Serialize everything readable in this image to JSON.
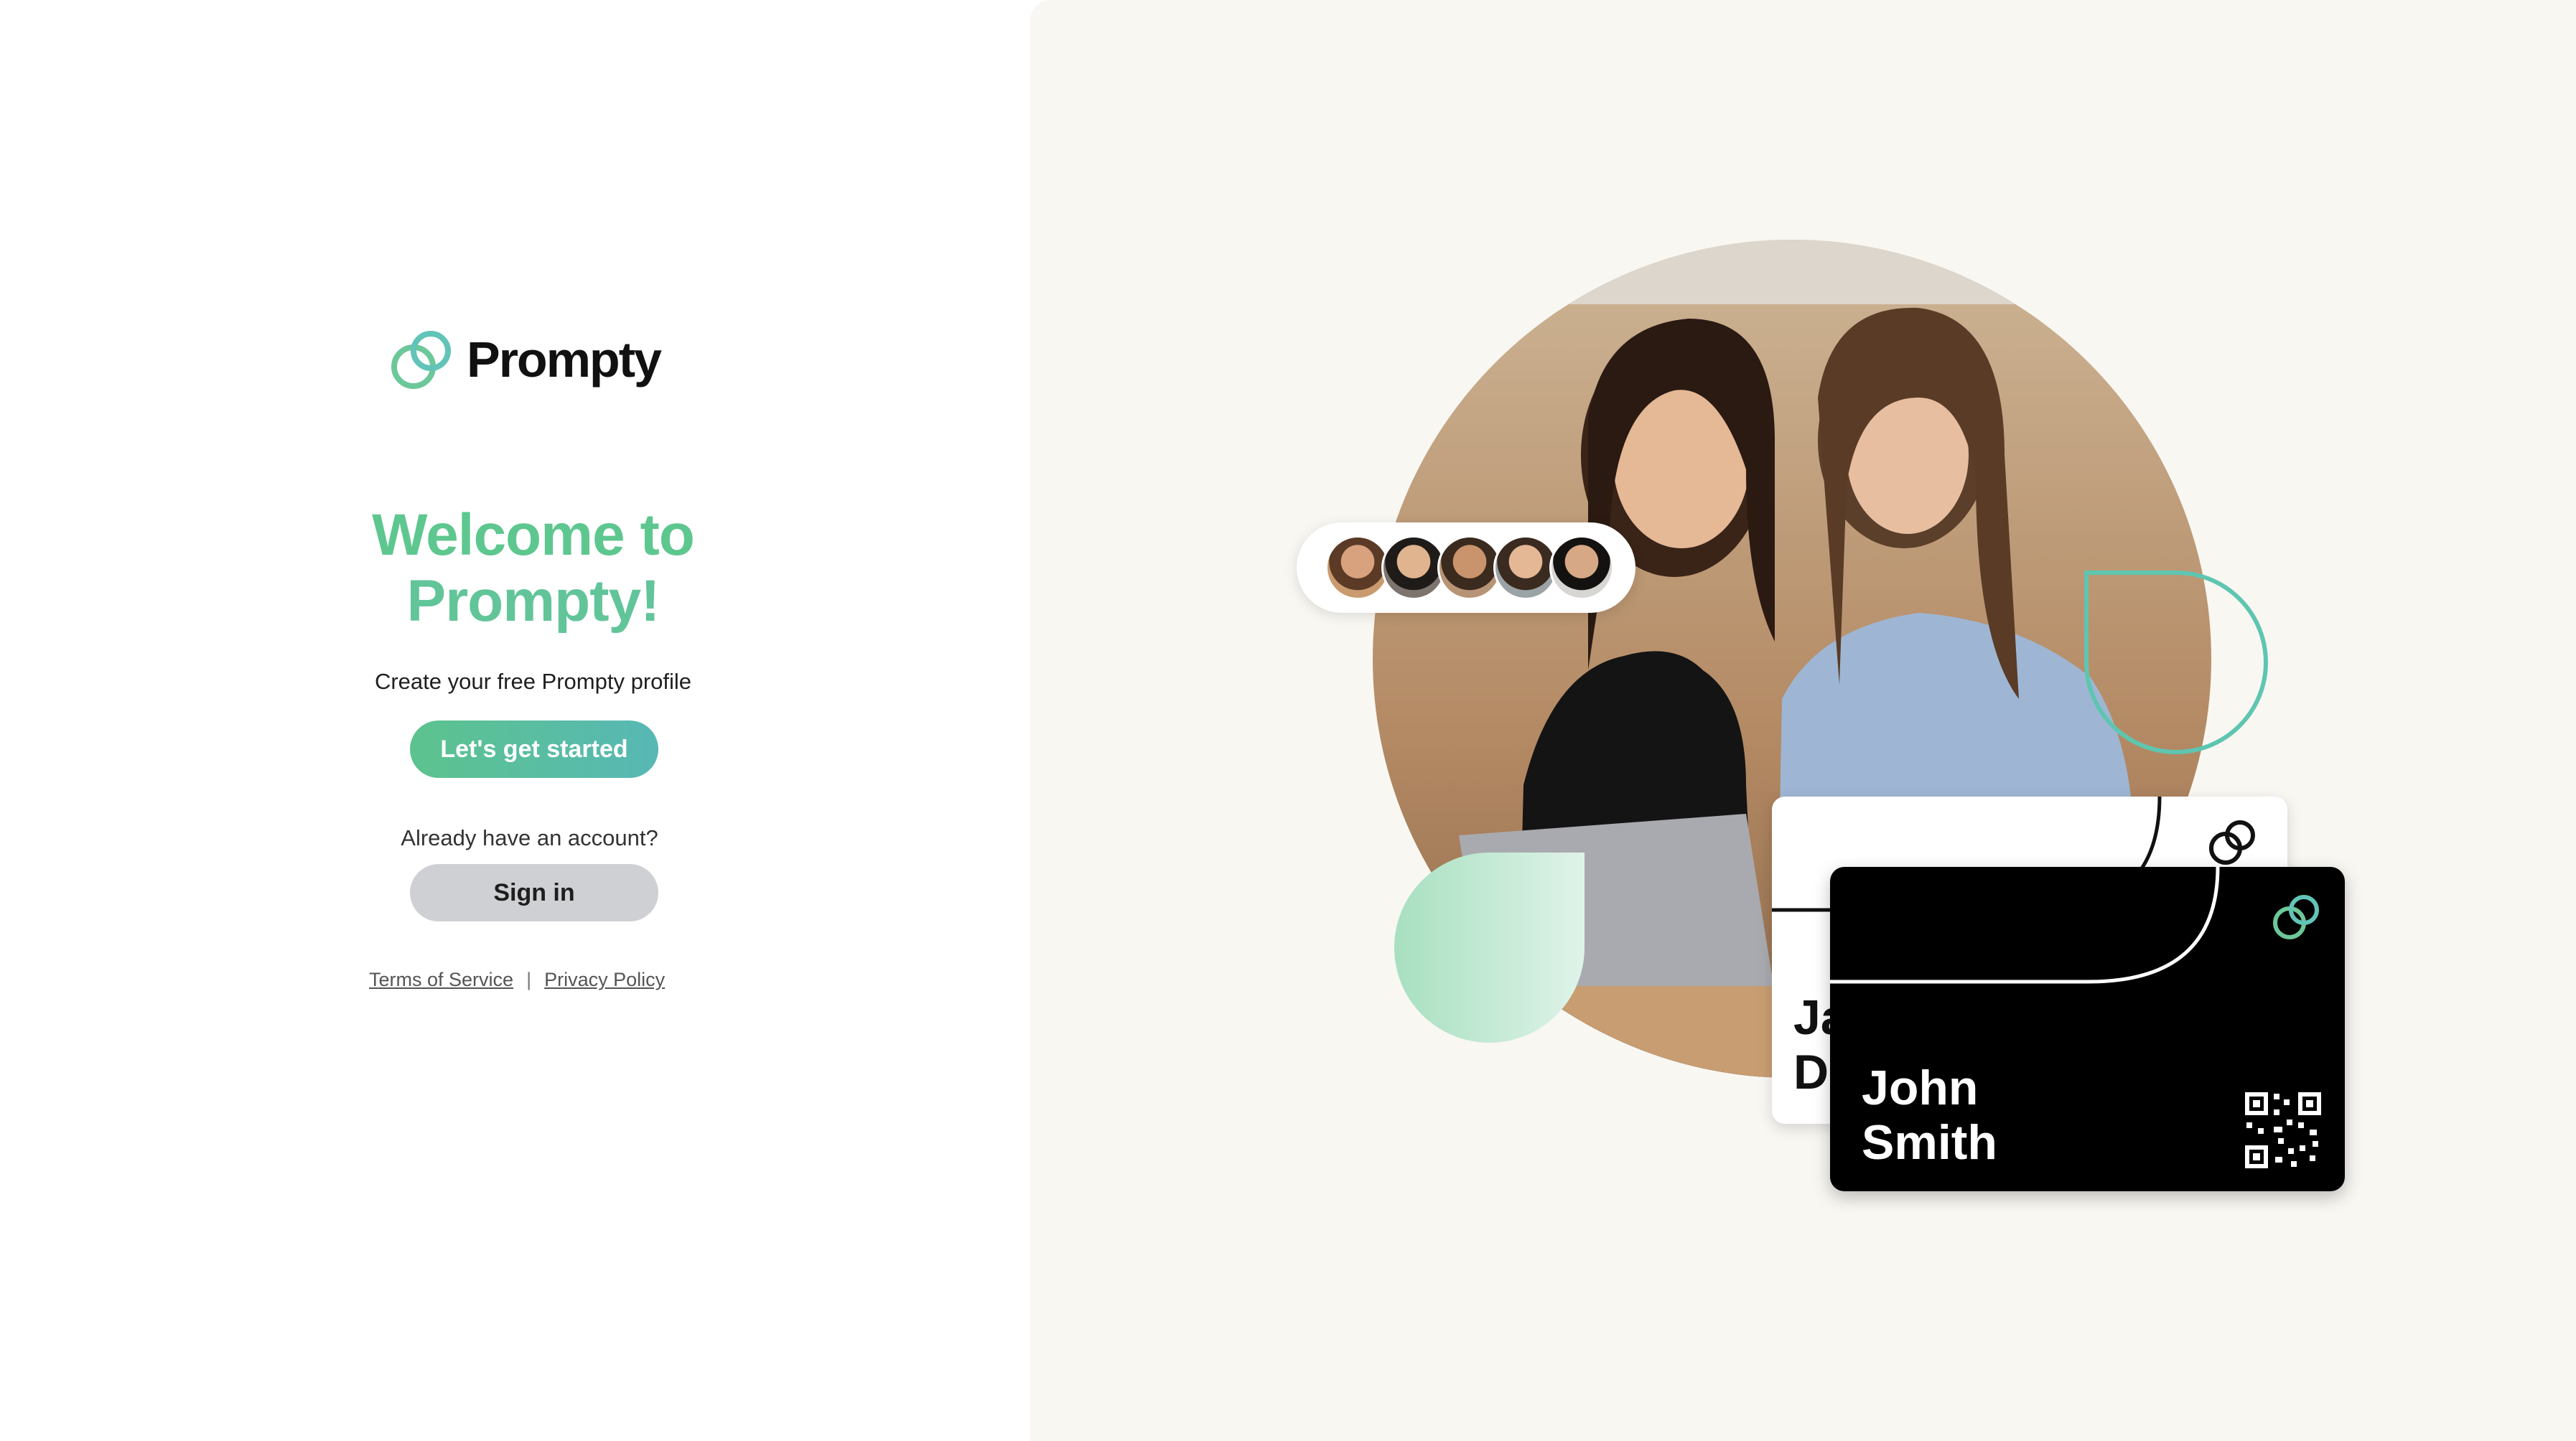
{
  "brand": {
    "name": "Prompty"
  },
  "welcome": {
    "title_line1": "Welcome to",
    "title_line2": "Prompty!",
    "subtitle": "Create your free Prompty profile",
    "start_button": "Let's get started",
    "already_text": "Already have an account?",
    "signin_button": "Sign in"
  },
  "footer_links": {
    "terms": "Terms of Service",
    "separator": "|",
    "privacy": "Privacy Policy"
  },
  "cards": {
    "back_card_name_line1": "Ja",
    "back_card_name_line2": "D",
    "front_card_name_line1": "John",
    "front_card_name_line2": "Smith"
  },
  "colors": {
    "accent_green": "#5ec78f",
    "accent_teal": "#57b8b5",
    "signin_gray": "#cfd0d3",
    "panel_bg": "#f9f7f2"
  },
  "icons": [
    "prompty-logo-icon",
    "qr-code-icon",
    "avatar-group"
  ]
}
